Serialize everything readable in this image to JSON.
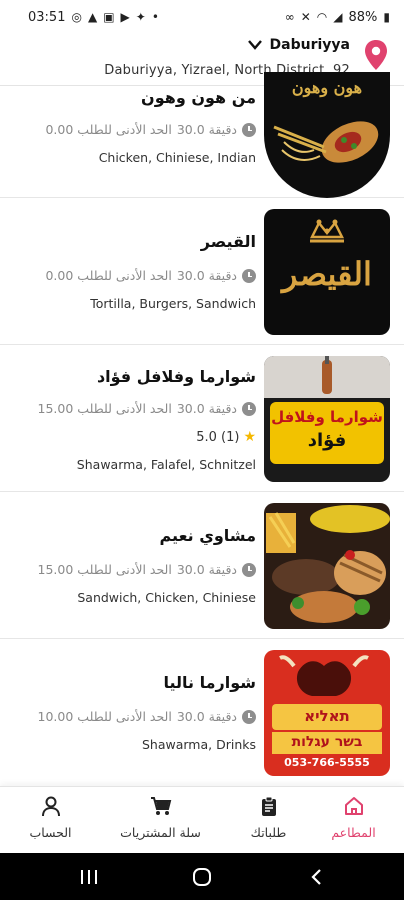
{
  "status_bar": {
    "time": "03:51",
    "battery": "88%"
  },
  "location": {
    "city": "Daburiyya",
    "address": "Daburiyya, Yizrael, North District ,92"
  },
  "restaurants": [
    {
      "name": "من هون وهون",
      "time": "30.0 دقيقة",
      "min_order": "0.00 الحد الأدنى للطلب",
      "rating": "",
      "tags": "Chicken, Chiniese, Indian"
    },
    {
      "name": "القيصر",
      "time": "30.0 دقيقة",
      "min_order": "0.00 الحد الأدنى للطلب",
      "rating": "",
      "tags": "Tortilla, Burgers, Sandwich"
    },
    {
      "name": "شوارما وفلافل فؤاد",
      "time": "30.0 دقيقة",
      "min_order": "15.00 الحد الأدنى للطلب",
      "rating": "5.0 (1)",
      "tags": "Shawarma, Falafel, Schnitzel"
    },
    {
      "name": "مشاوي نعيم",
      "time": "30.0 دقيقة",
      "min_order": "15.00 الحد الأدنى للطلب",
      "rating": "",
      "tags": "Sandwich, Chicken, Chiniese"
    },
    {
      "name": "شوارما ناليا",
      "time": "30.0 دقيقة",
      "min_order": "10.00 الحد الأدنى للطلب",
      "rating": "",
      "tags": "Shawarma, Drinks"
    }
  ],
  "thumb_text": {
    "t1": "هون وهون",
    "t2": "القيصر",
    "t3_top": "شوارما وفلافل",
    "t3_bottom": "فؤاد",
    "t5_top": "תאליא",
    "t5_mid": "בשר עגלות",
    "t5_phone": "053-766-5555"
  },
  "bottom_nav": {
    "restaurants": "المطاعم",
    "orders": "طلباتك",
    "cart": "سلة المشتريات",
    "account": "الحساب"
  },
  "colors": {
    "accent": "#e0426e"
  },
  "icons": {
    "location": "location-pin-icon",
    "clock": "clock-icon",
    "star": "star-icon",
    "home": "home-icon",
    "orders": "clipboard-icon",
    "cart": "cart-icon",
    "account": "person-icon"
  }
}
